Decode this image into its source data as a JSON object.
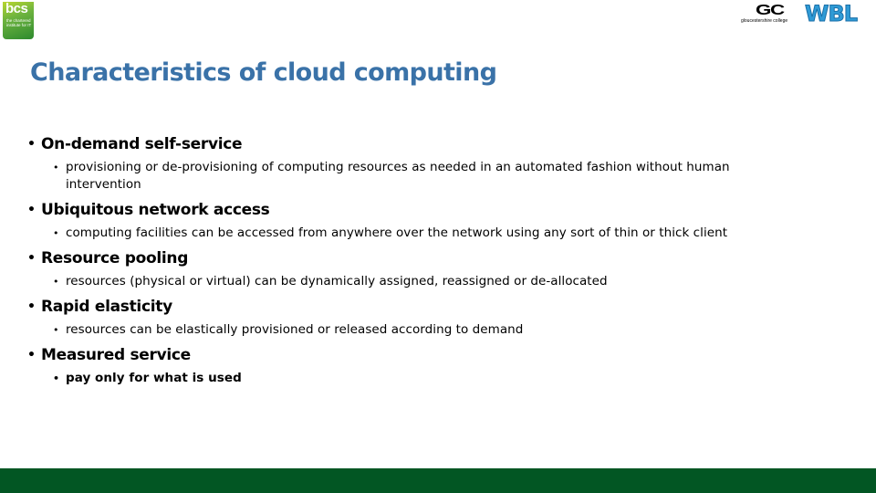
{
  "logos": {
    "bcs": {
      "mark": "bcs",
      "tagline": "the chartered institute for IT"
    },
    "gc": {
      "mark": "GC",
      "tagline": "gloucestershire college"
    },
    "wbl": {
      "mark": "WBL"
    }
  },
  "title": "Characteristics of cloud computing",
  "bullets": [
    {
      "heading": "On-demand self-service",
      "detail": "provisioning or de-provisioning of computing resources as needed in an automated fashion without human intervention"
    },
    {
      "heading": "Ubiquitous network access",
      "detail": "computing facilities can be accessed from anywhere over the network using any sort of thin or thick client"
    },
    {
      "heading": "Resource pooling",
      "detail": "resources (physical or virtual) can be dynamically assigned, reassigned or de-allocated"
    },
    {
      "heading": "Rapid elasticity",
      "detail": "resources can be elastically provisioned or released according to demand"
    },
    {
      "heading": "Measured service",
      "detail": "pay only for what is used"
    }
  ],
  "bullet_glyph": "•",
  "colors": {
    "title": "#3a72a8",
    "footer": "#025623"
  }
}
